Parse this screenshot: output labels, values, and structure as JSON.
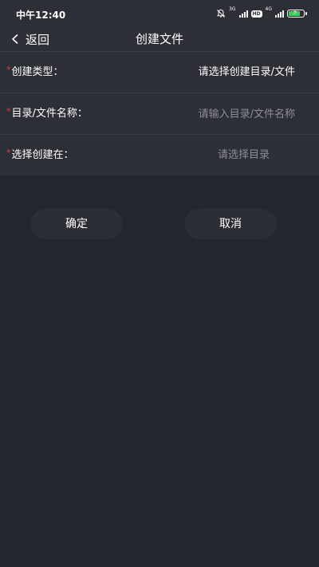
{
  "status_bar": {
    "time": "中午12:40",
    "network_1": "3G",
    "hd": "HD",
    "network_2": "4G",
    "battery_level": 0.8,
    "battery_color": "#3ecf5a"
  },
  "nav": {
    "back_label": "返回",
    "title": "创建文件"
  },
  "form": {
    "required_mark": "*",
    "type": {
      "label": "创建类型：",
      "value": "请选择创建目录/文件"
    },
    "name": {
      "label": "目录/文件名称：",
      "value": "",
      "placeholder": "请输入目录/文件名称"
    },
    "location": {
      "label": "选择创建在：",
      "value": "请选择目录"
    }
  },
  "actions": {
    "confirm": "确定",
    "cancel": "取消"
  },
  "colors": {
    "background": "#24262d",
    "panel": "#2d2f36",
    "required": "#e0433f",
    "placeholder": "#8d8f96"
  }
}
